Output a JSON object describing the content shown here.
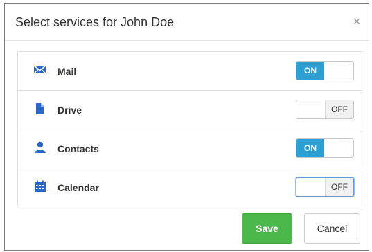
{
  "dialog": {
    "title": "Select services for John Doe",
    "close_glyph": "×"
  },
  "services": [
    {
      "label": "Mail",
      "icon": "envelope-icon",
      "state": "ON"
    },
    {
      "label": "Drive",
      "icon": "document-icon",
      "state": "OFF"
    },
    {
      "label": "Contacts",
      "icon": "user-icon",
      "state": "ON"
    },
    {
      "label": "Calendar",
      "icon": "calendar-icon",
      "state": "OFF"
    }
  ],
  "footer": {
    "save_label": "Save",
    "cancel_label": "Cancel"
  },
  "colors": {
    "accent": "#2d9fd3",
    "icon": "#2a67c9",
    "save": "#4cb84c"
  }
}
